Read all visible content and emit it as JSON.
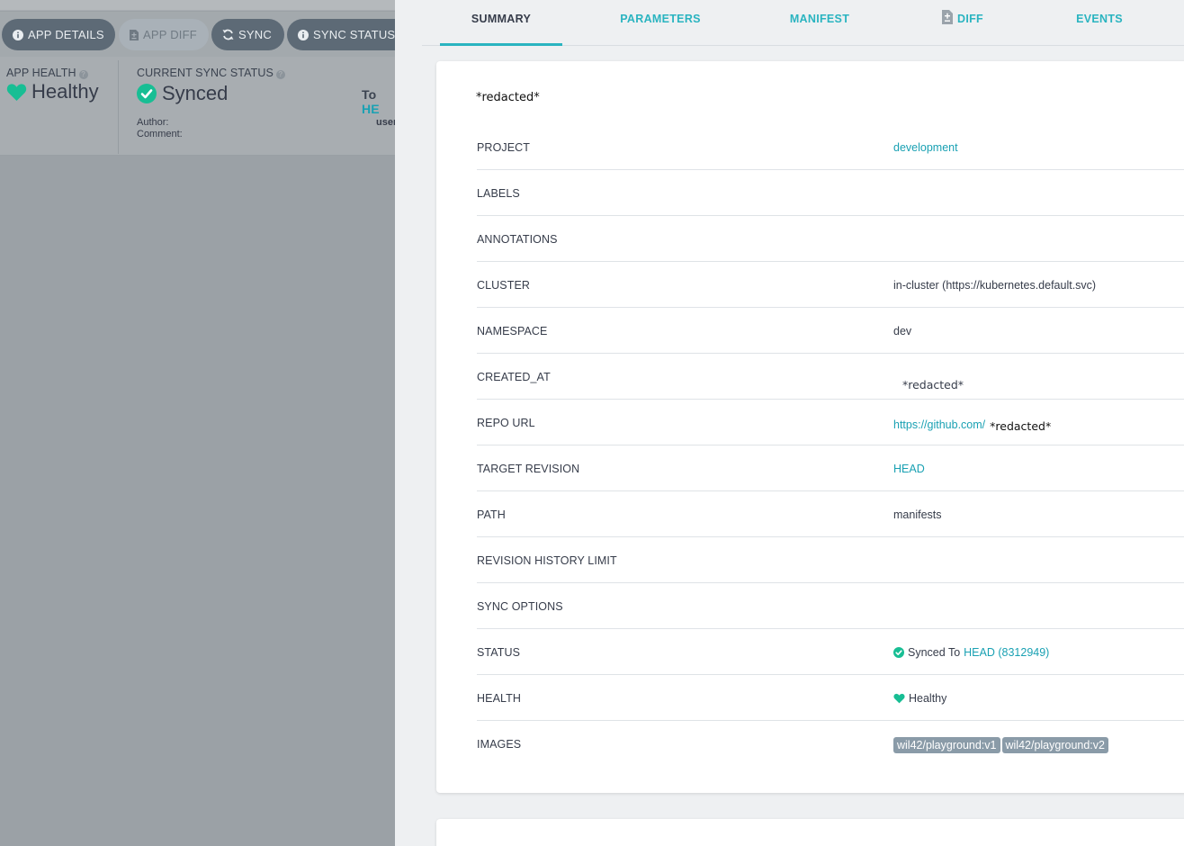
{
  "toolbar": {
    "app_details": "APP DETAILS",
    "app_diff": "APP DIFF",
    "sync": "SYNC",
    "sync_status": "SYNC STATUS"
  },
  "status_panel": {
    "health_label": "APP HEALTH",
    "health_value": "Healthy",
    "sync_label": "CURRENT SYNC STATUS",
    "sync_value": "Synced",
    "to_prefix": "To",
    "to_ref": "HE",
    "author_label": "Author:",
    "comment_label": "Comment:",
    "user_fragment": "user"
  },
  "tabs": [
    {
      "label": "SUMMARY",
      "active": true
    },
    {
      "label": "PARAMETERS",
      "active": false
    },
    {
      "label": "MANIFEST",
      "active": false
    },
    {
      "label": "DIFF",
      "active": false
    },
    {
      "label": "EVENTS",
      "active": false
    }
  ],
  "summary": {
    "app_name": "*redacted*",
    "rows": {
      "project": {
        "key": "PROJECT",
        "value": "development"
      },
      "labels": {
        "key": "LABELS",
        "value": ""
      },
      "annotations": {
        "key": "ANNOTATIONS",
        "value": ""
      },
      "cluster": {
        "key": "CLUSTER",
        "value": "in-cluster (https://kubernetes.default.svc)"
      },
      "namespace": {
        "key": "NAMESPACE",
        "value": "dev"
      },
      "created_at": {
        "key": "CREATED_AT",
        "value": "*redacted*"
      },
      "repo_url": {
        "key": "REPO URL",
        "link": "https://github.com/",
        "suffix": "*redacted*"
      },
      "target_revision": {
        "key": "TARGET REVISION",
        "value": "HEAD"
      },
      "path": {
        "key": "PATH",
        "value": "manifests"
      },
      "revision_history_limit": {
        "key": "REVISION HISTORY LIMIT",
        "value": ""
      },
      "sync_options": {
        "key": "SYNC OPTIONS",
        "value": ""
      },
      "status": {
        "key": "STATUS",
        "text": "Synced To",
        "link": "HEAD (8312949)"
      },
      "health": {
        "key": "HEALTH",
        "value": "Healthy"
      },
      "images": {
        "key": "IMAGES",
        "values": [
          "wil42/playground:v1",
          "wil42/playground:v2"
        ]
      }
    }
  },
  "colors": {
    "accent": "#2ab4c0",
    "link": "#1aa1b3",
    "healthy": "#18be94",
    "chip": "#8a9ba8"
  }
}
